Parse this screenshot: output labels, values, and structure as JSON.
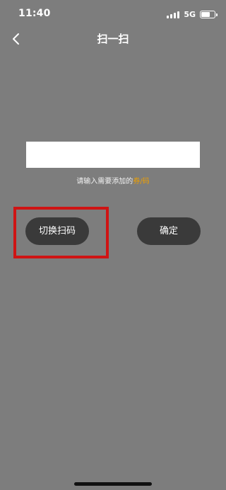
{
  "status_bar": {
    "time": "11:40",
    "network": "5G",
    "battery_percent": 70
  },
  "nav": {
    "title": "扫一扫",
    "back_icon": "chevron-left-icon"
  },
  "form": {
    "input_value": "",
    "hint_prefix": "请输入需要添加的",
    "hint_accent": "券/码"
  },
  "actions": {
    "switch_label": "切换扫码",
    "confirm_label": "确定"
  },
  "colors": {
    "background": "#7d7d7d",
    "button": "#3a3a3a",
    "accent": "#f0a000",
    "highlight": "#cf1414"
  }
}
